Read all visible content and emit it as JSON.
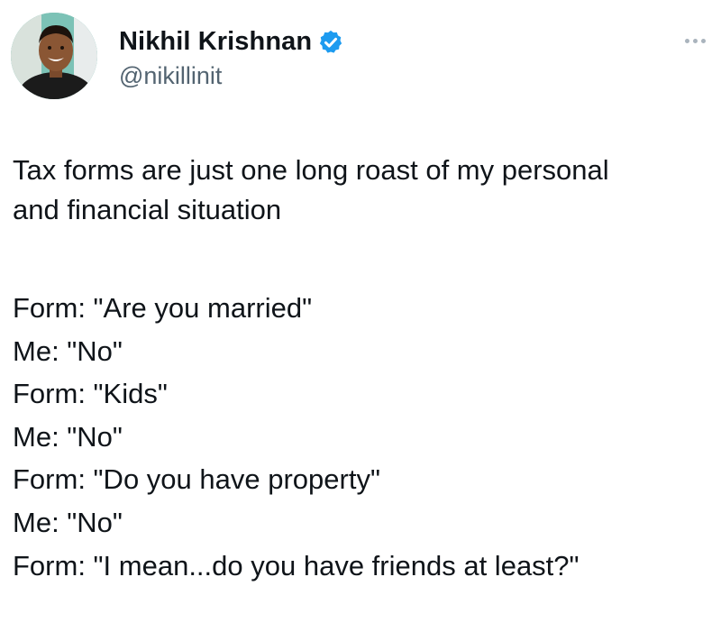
{
  "author": {
    "name": "Nikhil Krishnan",
    "handle": "@nikillinit",
    "verified": true,
    "verified_color": "#1d9bf0"
  },
  "menu_icon": "more-horizontal-icon",
  "tweet": {
    "intro": "Tax forms are just one long roast of my personal\nand financial situation",
    "lines": [
      "Form: \"Are you married\"",
      "Me: \"No\"",
      "Form: \"Kids\"",
      "Me: \"No\"",
      "Form: \"Do you have property\"",
      "Me: \"No\"",
      "Form: \"I mean...do you have friends at least?\""
    ]
  }
}
